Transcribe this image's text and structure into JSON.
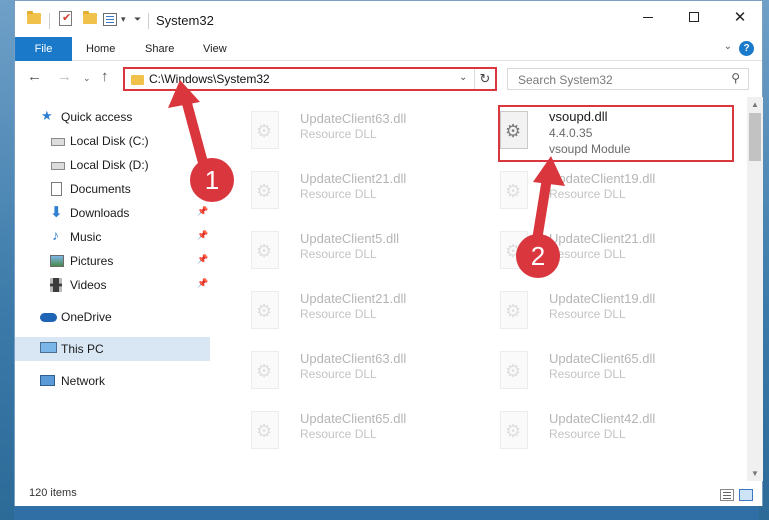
{
  "window": {
    "title": "System32"
  },
  "ribbon": {
    "tabs": [
      "File",
      "Home",
      "Share",
      "View"
    ]
  },
  "address_bar": {
    "path": "C:\\Windows\\System32"
  },
  "search": {
    "placeholder": "Search System32"
  },
  "sidebar": {
    "items": [
      {
        "label": "Quick access",
        "icon": "star-icon",
        "pinned": false
      },
      {
        "label": "Local Disk (C:)",
        "icon": "drive-icon",
        "pinned": false
      },
      {
        "label": "Local Disk (D:)",
        "icon": "drive-icon",
        "pinned": false
      },
      {
        "label": "Documents",
        "icon": "documents-icon",
        "pinned": false
      },
      {
        "label": "Downloads",
        "icon": "download-arrow-icon",
        "pinned": true
      },
      {
        "label": "Music",
        "icon": "music-note-icon",
        "pinned": true
      },
      {
        "label": "Pictures",
        "icon": "pictures-icon",
        "pinned": true
      },
      {
        "label": "Videos",
        "icon": "film-icon",
        "pinned": true
      },
      {
        "label": "OneDrive",
        "icon": "cloud-icon",
        "pinned": false
      },
      {
        "label": "This PC",
        "icon": "computer-icon",
        "pinned": false,
        "selected": true
      },
      {
        "label": "Network",
        "icon": "network-icon",
        "pinned": false
      }
    ]
  },
  "files": {
    "left": [
      {
        "name": "UpdateClient63.dll",
        "desc": "Resource DLL"
      },
      {
        "name": "UpdateClient21.dll",
        "desc": "Resource DLL"
      },
      {
        "name": "UpdateClient5.dll",
        "desc": "Resource DLL"
      },
      {
        "name": "UpdateClient21.dll",
        "desc": "Resource DLL"
      },
      {
        "name": "UpdateClient63.dll",
        "desc": "Resource DLL"
      },
      {
        "name": "UpdateClient65.dll",
        "desc": "Resource DLL"
      }
    ],
    "right": [
      {
        "name": "vsoupd.dll",
        "version": "4.4.0.35",
        "desc": "vsoupd Module",
        "highlighted": true
      },
      {
        "name": "UpdateClient19.dll",
        "desc": "Resource DLL"
      },
      {
        "name": "UpdateClient21.dll",
        "desc": "Resource DLL"
      },
      {
        "name": "UpdateClient19.dll",
        "desc": "Resource DLL"
      },
      {
        "name": "UpdateClient65.dll",
        "desc": "Resource DLL"
      },
      {
        "name": "UpdateClient42.dll",
        "desc": "Resource DLL"
      }
    ]
  },
  "status": {
    "item_count": "120 items"
  },
  "annotations": {
    "marker_1": "1",
    "marker_2": "2",
    "color": "#d9363e"
  }
}
